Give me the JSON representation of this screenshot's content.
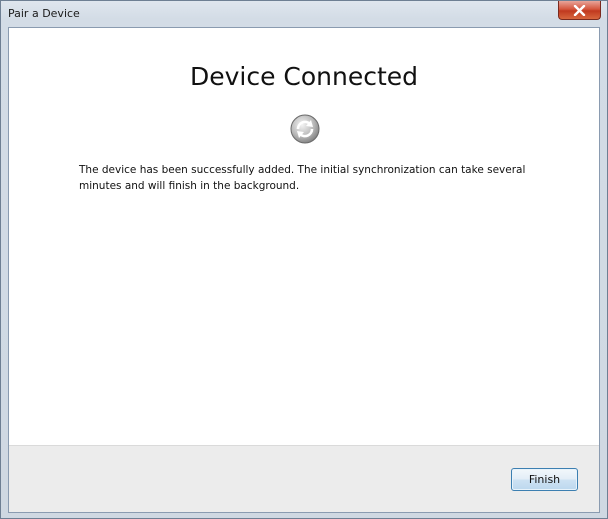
{
  "window": {
    "title": "Pair a Device",
    "close_icon": "close-icon"
  },
  "main": {
    "heading": "Device Connected",
    "status_icon": "sync-icon",
    "message": "The device has been successfully added. The initial synchronization can take several minutes and will finish in the background."
  },
  "footer": {
    "finish_label": "Finish"
  },
  "colors": {
    "close_button": "#c9472f",
    "client_background": "#ffffff",
    "footer_background": "#ececec",
    "button_border": "#3c7fb1"
  }
}
